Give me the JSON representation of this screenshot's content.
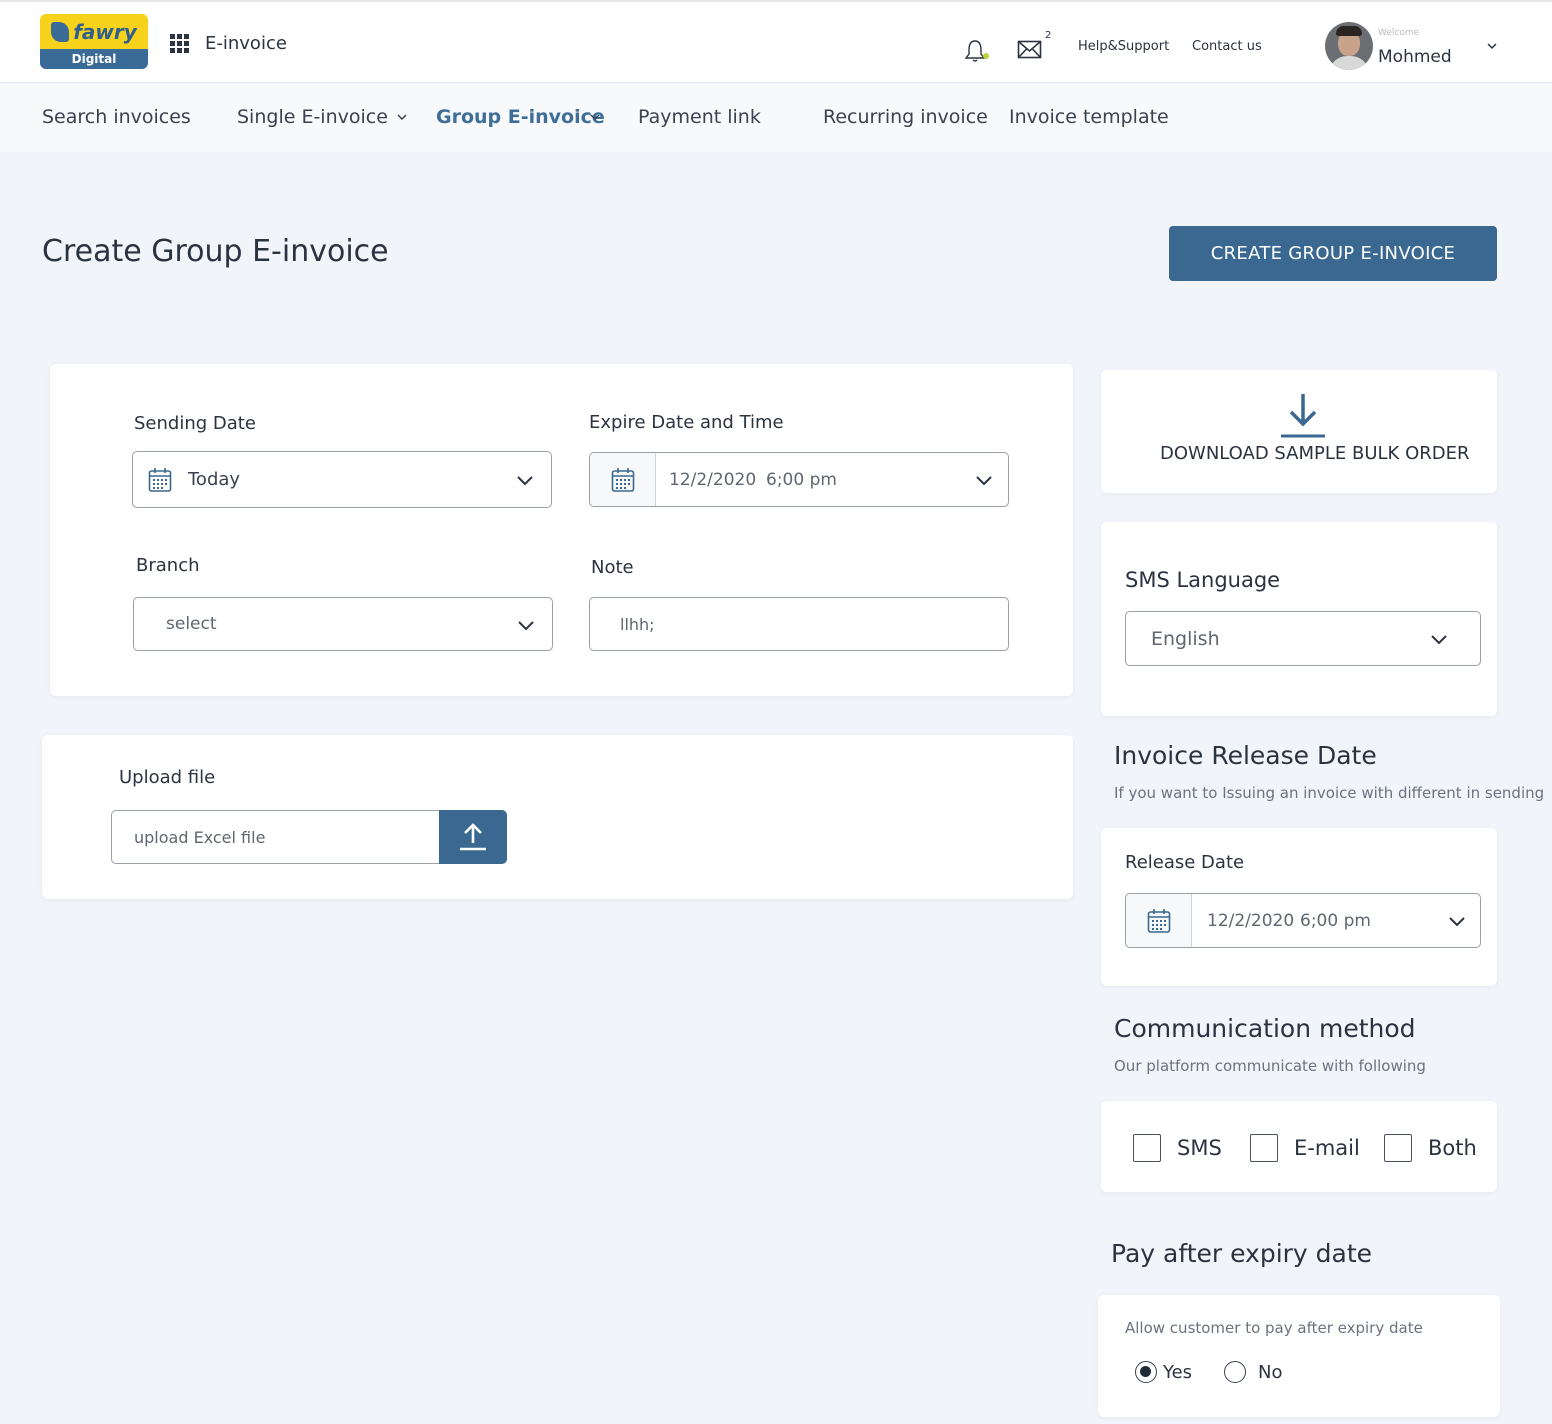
{
  "header": {
    "logo_word": "fawry",
    "logo_sub": "Digital",
    "app_title": "E-invoice",
    "mail_count": "2",
    "help_link": "Help&Support",
    "contact_link": "Contact us",
    "welcome": "Welcome",
    "username": "Mohmed"
  },
  "nav": {
    "items": [
      {
        "label": "Search invoices"
      },
      {
        "label": "Single E-invoice"
      },
      {
        "label": "Group E-invoice"
      },
      {
        "label": "Payment link"
      },
      {
        "label": "Recurring invoice"
      },
      {
        "label": "Invoice template"
      }
    ],
    "active": "Group E-invoice"
  },
  "page": {
    "title": "Create Group E-invoice",
    "create_button": "CREATE GROUP E-INVOICE"
  },
  "form": {
    "sending_date_label": "Sending  Date",
    "sending_date_value": "Today",
    "expire_label": "Expire  Date and Time",
    "expire_date": "12/2/2020",
    "expire_time": "6;00 pm",
    "branch_label": "Branch",
    "branch_placeholder": "select",
    "note_label": "Note",
    "note_value": "llhh;"
  },
  "upload": {
    "label": "Upload file",
    "placeholder": "upload  Excel file"
  },
  "sidebar": {
    "download_label": "DOWNLOAD SAMPLE BULK ORDER",
    "sms_language_label": "SMS Language",
    "sms_language_value": "English",
    "release_title": "Invoice Release Date",
    "release_sub": "If you want to Issuing an invoice with different in sending",
    "release_label": "Release Date",
    "release_date": "12/2/2020",
    "release_time": "6;00 pm",
    "comm_title": "Communication method",
    "comm_sub": "Our platform communicate  with following",
    "comm_options": [
      "SMS",
      "E-mail",
      "Both"
    ],
    "pay_title": "Pay after expiry date",
    "pay_sub": "Allow customer to pay after expiry date",
    "pay_yes": "Yes",
    "pay_no": "No",
    "pay_selected": "Yes"
  },
  "colors": {
    "primary": "#3a6890",
    "accent_nav": "#3f6f99",
    "logo_yellow": "#f7d21b",
    "background": "#f1f4f9"
  }
}
